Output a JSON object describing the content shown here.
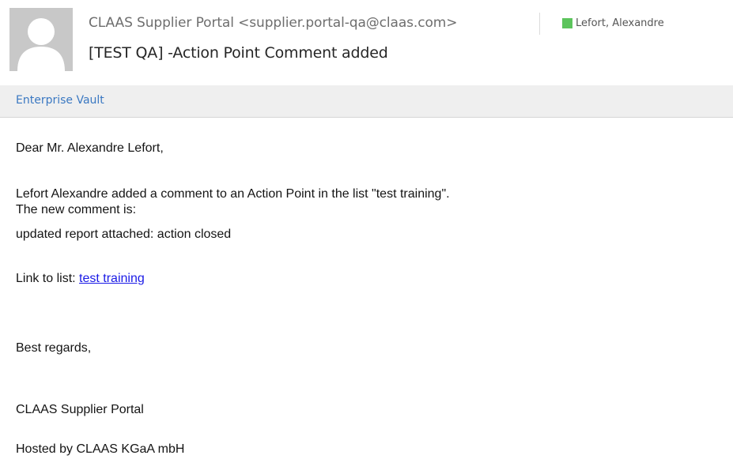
{
  "header": {
    "sender": "CLAAS Supplier Portal <supplier.portal-qa@claas.com>",
    "recipient": "Lefort, Alexandre",
    "subject": "[TEST QA] -Action Point Comment added",
    "presence_color": "#5cc45c"
  },
  "enterprise_vault": {
    "label": "Enterprise Vault"
  },
  "body": {
    "greeting": "Dear Mr. Alexandre Lefort,",
    "line1": "Lefort Alexandre added a comment to an Action Point in the list \"test training\".",
    "line2": "The new comment is:",
    "line3": "updated report attached: action closed",
    "link_prefix": "Link to list: ",
    "link_text": "test training",
    "closing": "Best regards,",
    "signature": "CLAAS Supplier Portal",
    "hosted": "Hosted by CLAAS KGaA mbH"
  },
  "icons": {
    "avatar": "person-silhouette-icon",
    "presence": "presence-status-icon"
  }
}
